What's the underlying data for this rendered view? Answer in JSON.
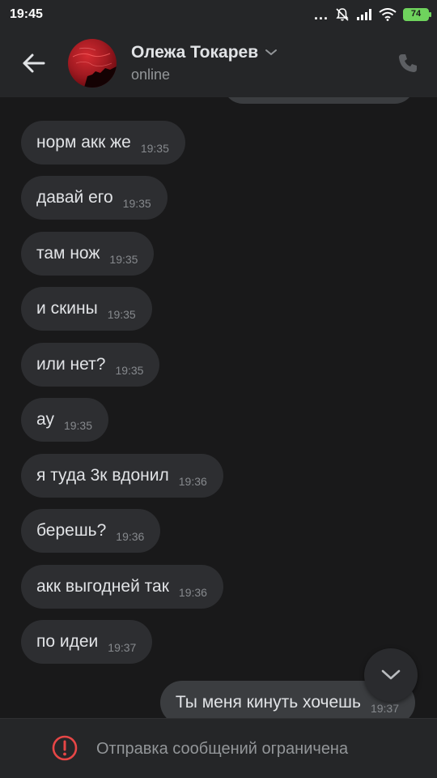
{
  "status_bar": {
    "time": "19:45",
    "battery": "74",
    "dots": "...",
    "icons": [
      "mute-icon",
      "signal-icon",
      "wifi-icon",
      "battery-icon"
    ]
  },
  "header": {
    "back_icon": "arrow-left-icon",
    "contact_name": "Олежа Токарев",
    "contact_status": "online",
    "call_icon": "phone-icon",
    "dropdown_icon": "chevron-down-icon"
  },
  "messages": [
    {
      "text": "норм акк же",
      "time": "19:35"
    },
    {
      "text": "давай его",
      "time": "19:35"
    },
    {
      "text": "там нож",
      "time": "19:35"
    },
    {
      "text": "и скины",
      "time": "19:35"
    },
    {
      "text": "или нет?",
      "time": "19:35"
    },
    {
      "text": "ау",
      "time": "19:35"
    },
    {
      "text": "я туда 3к вдонил",
      "time": "19:36"
    },
    {
      "text": "берешь?",
      "time": "19:36"
    },
    {
      "text": "акк выгодней так",
      "time": "19:36"
    },
    {
      "text": "по идеи",
      "time": "19:37"
    }
  ],
  "outgoing": {
    "text": "Ты меня кинуть хочешь",
    "time": "19:37"
  },
  "footer": {
    "notice": "Отправка сообщений ограничена",
    "icon": "warning-icon"
  },
  "colors": {
    "background": "#19191a",
    "header": "#252628",
    "incoming_bubble": "#2d2e31",
    "outgoing_bubble": "#3b3d40",
    "warning": "#e64646",
    "battery": "#6fd35d"
  }
}
